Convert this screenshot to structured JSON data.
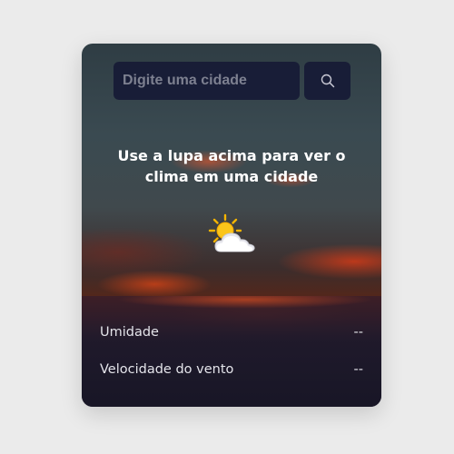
{
  "search": {
    "placeholder": "Digite uma cidade",
    "button_icon": "search-icon"
  },
  "message": {
    "line1": "Use a lupa acima para ver o",
    "line2": "clima em uma cidade"
  },
  "weather": {
    "icon": "sun-behind-cloud-icon"
  },
  "details": {
    "humidity_label": "Umidade",
    "humidity_value": "--",
    "wind_label": "Velocidade do vento",
    "wind_value": "--"
  },
  "colors": {
    "page_background": "#ebebeb",
    "input_background": "#141834",
    "text": "#ffffff"
  }
}
